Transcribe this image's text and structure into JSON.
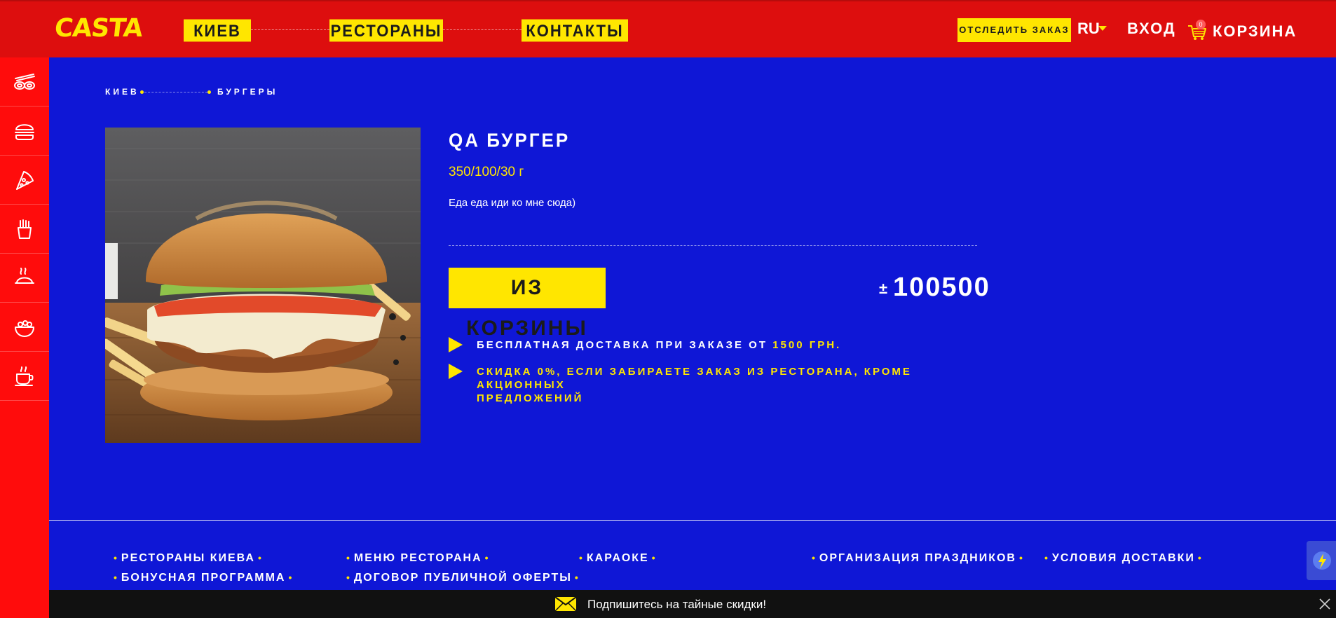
{
  "header": {
    "logo": "CASTA",
    "nav": [
      "КИЕВ",
      "РЕСТОРАНЫ",
      "КОНТАКТЫ"
    ],
    "track_order": "ОТСЛЕДИТЬ ЗАКАЗ",
    "language": "RU",
    "login": "ВХОД",
    "cart_label": "КОРЗИНА",
    "cart_count": "0"
  },
  "sidebar": {
    "items": [
      "sushi-icon",
      "burger-icon",
      "pizza-icon",
      "fries-icon",
      "dish-icon",
      "salad-icon",
      "cup-icon"
    ]
  },
  "breadcrumb": [
    "КИЕВ",
    "БУРГЕРЫ"
  ],
  "product": {
    "title": "QA БУРГЕР",
    "weight": "350/100/30 г",
    "description": "Еда еда иди ко мне сюда)",
    "cart_button": "ИЗ КОРЗИНЫ",
    "price_sign": "±",
    "price": "100500"
  },
  "info": {
    "delivery_text": "БЕСПЛАТНАЯ ДОСТАВКА ПРИ ЗАКАЗЕ ОТ",
    "delivery_amount": "1500 ГРН.",
    "discount_line1": "СКИДКА 0%, ЕСЛИ ЗАБИРАЕТЕ ЗАКАЗ ИЗ РЕСТОРАНА, КРОМЕ АКЦИОННЫХ",
    "discount_line2": "ПРЕДЛОЖЕНИЙ"
  },
  "footer": {
    "links": [
      "РЕСТОРАНЫ КИЕВА",
      "МЕНЮ РЕСТОРАНА",
      "КАРАОКЕ",
      "ОРГАНИЗАЦИЯ ПРАЗДНИКОВ",
      "УСЛОВИЯ ДОСТАВКИ",
      "БОНУСНАЯ ПРОГРАММА",
      "ДОГОВОР ПУБЛИЧНОЙ ОФЕРТЫ"
    ],
    "subscribe_text": "Подпишитесь на тайные скидки!"
  },
  "colors": {
    "header_red": "#dd0e0e",
    "sidebar_red": "#ff0c0c",
    "main_blue": "#0f17d6",
    "accent_yellow": "#ffe600",
    "bar_dark": "#111111"
  }
}
